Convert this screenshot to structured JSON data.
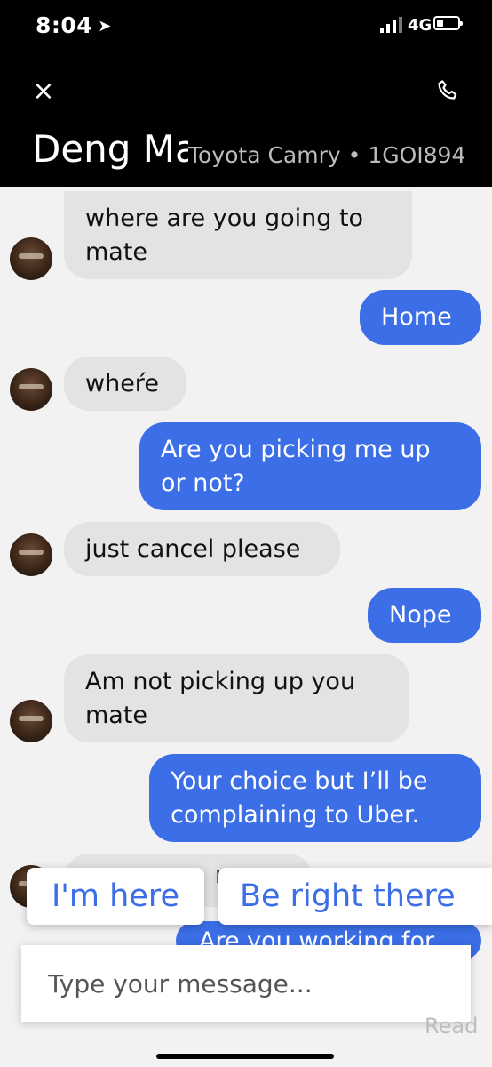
{
  "status": {
    "time": "8:04",
    "network": "4G"
  },
  "header": {
    "driver_name": "Deng Ma",
    "car_info": "Toyota Camry • 1GOI894"
  },
  "messages": [
    {
      "from": "driver",
      "text_lines": [
        "where are you going to",
        "mate"
      ]
    },
    {
      "from": "me",
      "text_lines": [
        "Home"
      ]
    },
    {
      "from": "driver",
      "text_lines": [
        "wheŕe"
      ]
    },
    {
      "from": "me",
      "text_lines": [
        "Are you picking me up",
        "or not?"
      ]
    },
    {
      "from": "driver",
      "text_lines": [
        "just cancel please"
      ]
    },
    {
      "from": "me",
      "text_lines": [
        "Nope"
      ]
    },
    {
      "from": "driver",
      "text_lines": [
        "Am not picking up you",
        "mate"
      ]
    },
    {
      "from": "me",
      "text_lines": [
        "Your choice but I’ll be",
        "complaining to Uber."
      ]
    },
    {
      "from": "driver",
      "text_lines": [
        "ro"
      ]
    },
    {
      "from": "me",
      "text_lines": [
        "Are you working for"
      ]
    }
  ],
  "quick_replies": [
    "I'm here",
    "Be right there"
  ],
  "composer": {
    "placeholder": "Type your message..."
  },
  "read_receipt": "Read",
  "icons": {
    "close": "close-icon",
    "phone": "phone-icon",
    "location": "location-arrow-icon",
    "signal": "signal-icon",
    "battery": "battery-icon"
  },
  "colors": {
    "outgoing": "#3b6ee7",
    "incoming": "#e3e3e3",
    "header": "#000000",
    "background": "#f2f2f2"
  }
}
